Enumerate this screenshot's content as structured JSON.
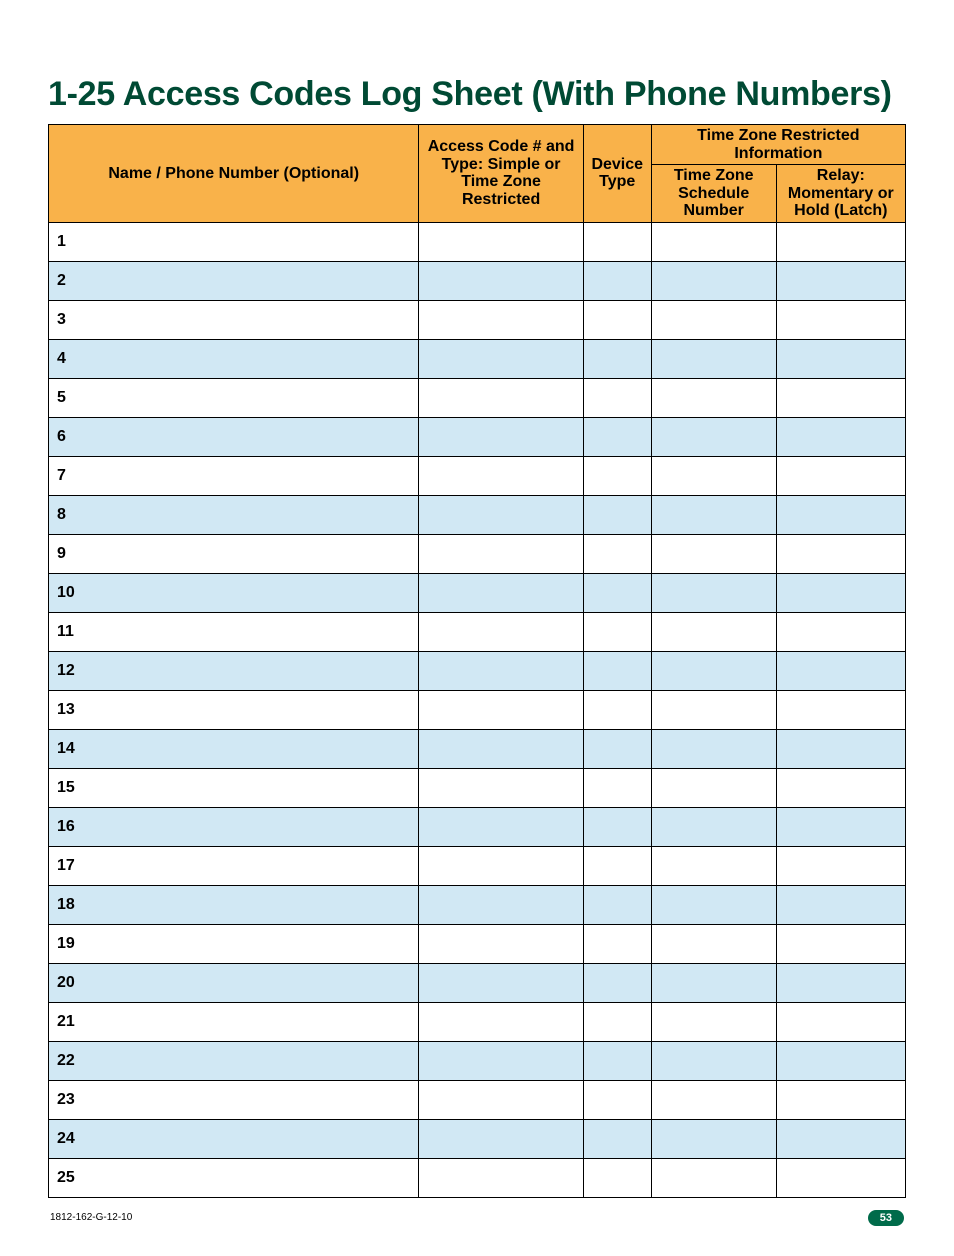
{
  "title": "1-25 Access Codes Log Sheet (With Phone Numbers)",
  "headers": {
    "name": "Name / Phone Number (Optional)",
    "access_code": "Access Code # and Type: Simple or Time Zone Restricted",
    "device_type": "Device Type",
    "tz_group": "Time Zone Restricted Information",
    "tz_schedule": "Time Zone Schedule Number",
    "relay": "Relay: Momentary or Hold (Latch)"
  },
  "rows": [
    {
      "num": "1",
      "name": "",
      "code": "",
      "device": "",
      "tz": "",
      "relay": ""
    },
    {
      "num": "2",
      "name": "",
      "code": "",
      "device": "",
      "tz": "",
      "relay": ""
    },
    {
      "num": "3",
      "name": "",
      "code": "",
      "device": "",
      "tz": "",
      "relay": ""
    },
    {
      "num": "4",
      "name": "",
      "code": "",
      "device": "",
      "tz": "",
      "relay": ""
    },
    {
      "num": "5",
      "name": "",
      "code": "",
      "device": "",
      "tz": "",
      "relay": ""
    },
    {
      "num": "6",
      "name": "",
      "code": "",
      "device": "",
      "tz": "",
      "relay": ""
    },
    {
      "num": "7",
      "name": "",
      "code": "",
      "device": "",
      "tz": "",
      "relay": ""
    },
    {
      "num": "8",
      "name": "",
      "code": "",
      "device": "",
      "tz": "",
      "relay": ""
    },
    {
      "num": "9",
      "name": "",
      "code": "",
      "device": "",
      "tz": "",
      "relay": ""
    },
    {
      "num": "10",
      "name": "",
      "code": "",
      "device": "",
      "tz": "",
      "relay": ""
    },
    {
      "num": "11",
      "name": "",
      "code": "",
      "device": "",
      "tz": "",
      "relay": ""
    },
    {
      "num": "12",
      "name": "",
      "code": "",
      "device": "",
      "tz": "",
      "relay": ""
    },
    {
      "num": "13",
      "name": "",
      "code": "",
      "device": "",
      "tz": "",
      "relay": ""
    },
    {
      "num": "14",
      "name": "",
      "code": "",
      "device": "",
      "tz": "",
      "relay": ""
    },
    {
      "num": "15",
      "name": "",
      "code": "",
      "device": "",
      "tz": "",
      "relay": ""
    },
    {
      "num": "16",
      "name": "",
      "code": "",
      "device": "",
      "tz": "",
      "relay": ""
    },
    {
      "num": "17",
      "name": "",
      "code": "",
      "device": "",
      "tz": "",
      "relay": ""
    },
    {
      "num": "18",
      "name": "",
      "code": "",
      "device": "",
      "tz": "",
      "relay": ""
    },
    {
      "num": "19",
      "name": "",
      "code": "",
      "device": "",
      "tz": "",
      "relay": ""
    },
    {
      "num": "20",
      "name": "",
      "code": "",
      "device": "",
      "tz": "",
      "relay": ""
    },
    {
      "num": "21",
      "name": "",
      "code": "",
      "device": "",
      "tz": "",
      "relay": ""
    },
    {
      "num": "22",
      "name": "",
      "code": "",
      "device": "",
      "tz": "",
      "relay": ""
    },
    {
      "num": "23",
      "name": "",
      "code": "",
      "device": "",
      "tz": "",
      "relay": ""
    },
    {
      "num": "24",
      "name": "",
      "code": "",
      "device": "",
      "tz": "",
      "relay": ""
    },
    {
      "num": "25",
      "name": "",
      "code": "",
      "device": "",
      "tz": "",
      "relay": ""
    }
  ],
  "footer": {
    "doc_code": "1812-162-G-12-10",
    "page_number": "53"
  }
}
